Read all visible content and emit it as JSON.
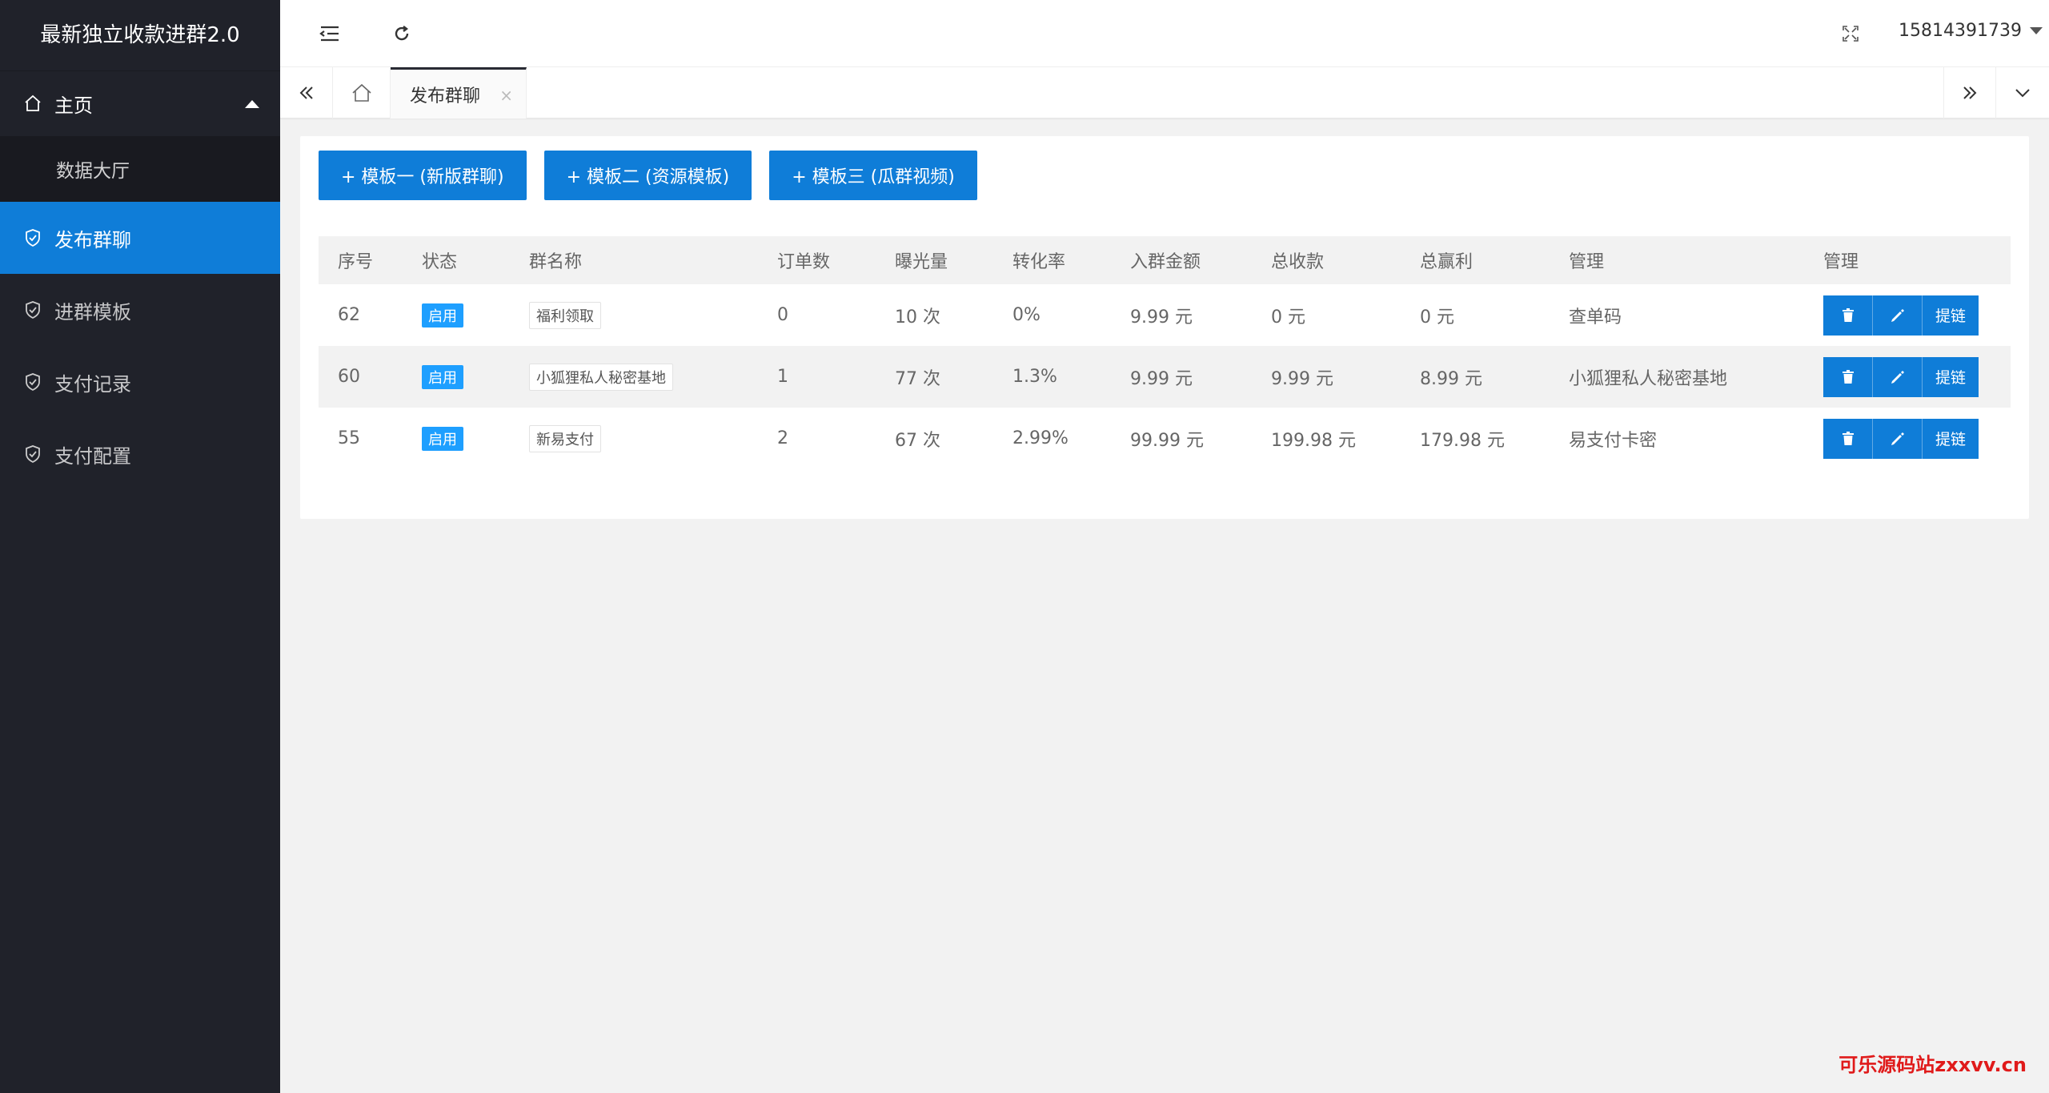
{
  "app": {
    "brand": "最新独立收款进群2.0"
  },
  "sidebar": {
    "home_label": "主页",
    "sub_item": "数据大厅",
    "items": [
      {
        "label": "发布群聊",
        "active": true
      },
      {
        "label": "进群模板",
        "active": false
      },
      {
        "label": "支付记录",
        "active": false
      },
      {
        "label": "支付配置",
        "active": false
      }
    ]
  },
  "header": {
    "user": "15814391739"
  },
  "tabs": {
    "active_label": "发布群聊",
    "close_symbol": "×"
  },
  "actions": {
    "btn1": "+ 模板一 (新版群聊)",
    "btn2": "+ 模板二 (资源模板)",
    "btn3": "+ 模板三 (瓜群视频)"
  },
  "table": {
    "headers": [
      "序号",
      "状态",
      "群名称",
      "订单数",
      "曝光量",
      "转化率",
      "入群金额",
      "总收款",
      "总赢利",
      "管理",
      "管理"
    ],
    "rows": [
      {
        "id": "62",
        "status": "启用",
        "name": "福利领取",
        "orders": "0",
        "views": "10 次",
        "rate": "0%",
        "price": "9.99 元",
        "total": "0 元",
        "profit": "0 元",
        "manage": "查单码",
        "link_btn": "提链"
      },
      {
        "id": "60",
        "status": "启用",
        "name": "小狐狸私人秘密基地",
        "orders": "1",
        "views": "77 次",
        "rate": "1.3%",
        "price": "9.99 元",
        "total": "9.99 元",
        "profit": "8.99 元",
        "manage": "小狐狸私人秘密基地",
        "link_btn": "提链"
      },
      {
        "id": "55",
        "status": "启用",
        "name": "新易支付",
        "orders": "2",
        "views": "67 次",
        "rate": "2.99%",
        "price": "99.99 元",
        "total": "199.98 元",
        "profit": "179.98 元",
        "manage": "易支付卡密",
        "link_btn": "提链"
      }
    ]
  },
  "watermark": "可乐源码站zxxvv.cn",
  "colors": {
    "sidebar_bg": "#20222a",
    "accent": "#0f7dd8",
    "badge": "#1e9fff"
  }
}
